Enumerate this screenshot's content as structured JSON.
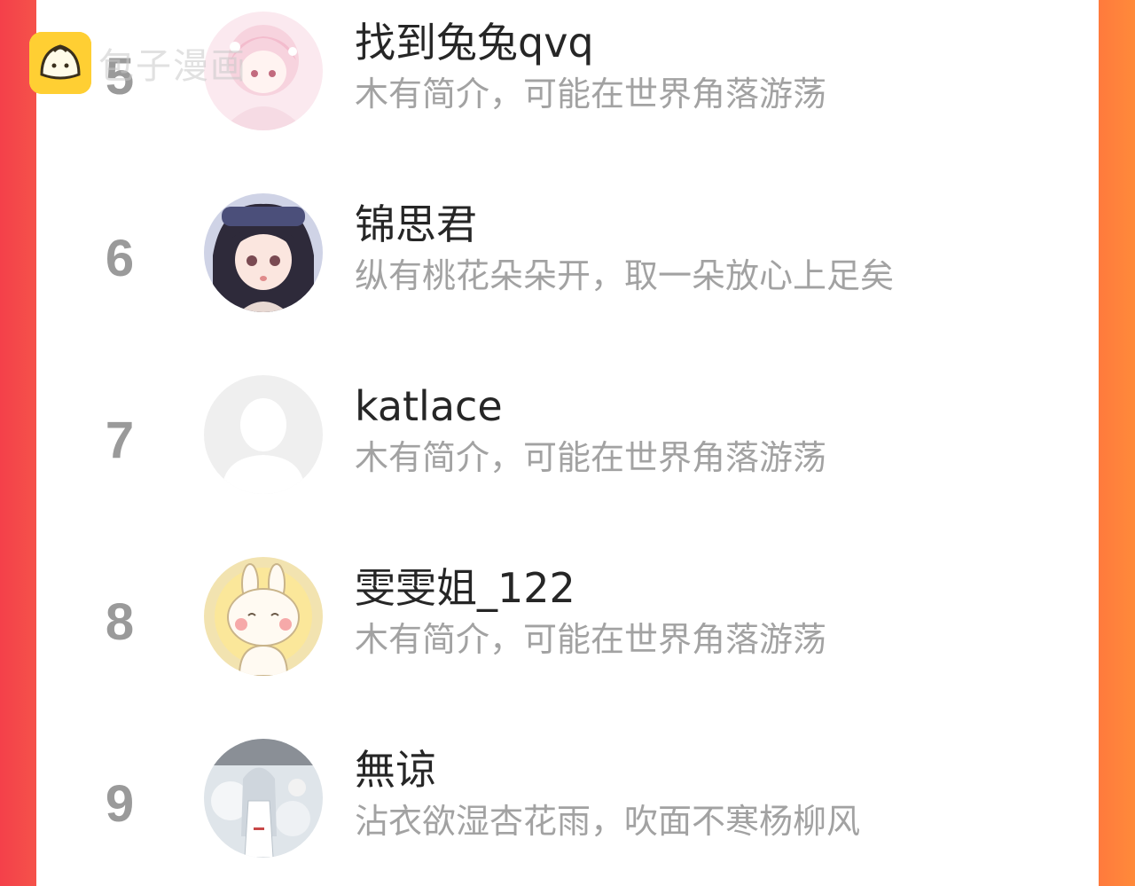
{
  "watermark": {
    "text": "包子漫画"
  },
  "users": [
    {
      "rank": "5",
      "name": "找到兔兔qvq",
      "bio": "木有简介，可能在世界角落游荡",
      "avatar_icon": "anime-girl-pink-avatar"
    },
    {
      "rank": "6",
      "name": "锦思君",
      "bio": "纵有桃花朵朵开，取一朵放心上足矣",
      "avatar_icon": "anime-girl-dark-hair-avatar"
    },
    {
      "rank": "7",
      "name": "katlace",
      "bio": "木有简介，可能在世界角落游荡",
      "avatar_icon": "default-user-avatar"
    },
    {
      "rank": "8",
      "name": "雯雯姐_122",
      "bio": "木有简介，可能在世界角落游荡",
      "avatar_icon": "bunny-avatar"
    },
    {
      "rank": "9",
      "name": "無谅",
      "bio": "沾衣欲湿杏花雨，吹面不寒杨柳风",
      "avatar_icon": "anime-scene-avatar"
    }
  ],
  "colors": {
    "left_border": "#f4404a",
    "right_border": "#ff7a3d",
    "rank": "#9a9a9a",
    "name": "#262626",
    "bio": "#a2a2a2"
  }
}
